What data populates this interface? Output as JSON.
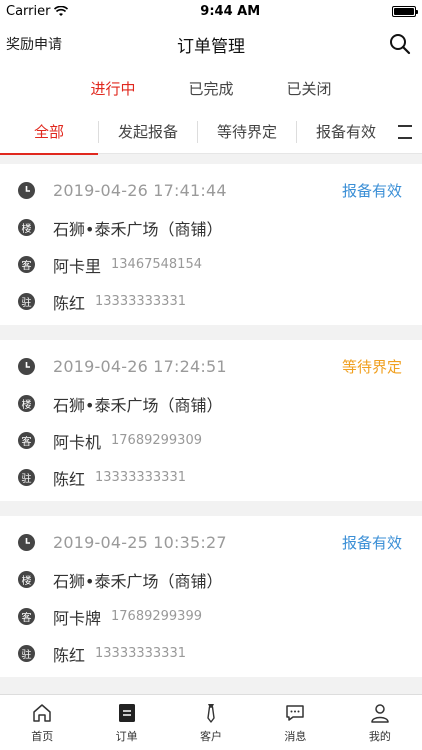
{
  "status_bar": {
    "carrier": "Carrier",
    "time": "9:44 AM",
    "wifi_icon": "wifi-icon",
    "battery_level": 1.0
  },
  "nav": {
    "left_label": "奖励申请",
    "title": "订单管理",
    "search_icon": "search-icon"
  },
  "status_tabs": [
    {
      "label": "进行中",
      "active": true
    },
    {
      "label": "已完成",
      "active": false
    },
    {
      "label": "已关闭",
      "active": false
    }
  ],
  "filter_tabs": [
    {
      "label": "全部",
      "active": true
    },
    {
      "label": "发起报备",
      "active": false
    },
    {
      "label": "等待界定",
      "active": false
    },
    {
      "label": "报备有效",
      "active": false
    }
  ],
  "badges": {
    "building": "楼",
    "customer": "客",
    "agent": "驻"
  },
  "orders": [
    {
      "time": "2019-04-26 17:41:44",
      "status": "报备有效",
      "status_color": "#3b8fd6",
      "property": "石狮•泰禾广场（商铺）",
      "customer_name": "阿卡里",
      "customer_phone": "13467548154",
      "agent_name": "陈红",
      "agent_phone": "13333333331"
    },
    {
      "time": "2019-04-26 17:24:51",
      "status": "等待界定",
      "status_color": "#f0a020",
      "property": "石狮•泰禾广场（商铺）",
      "customer_name": "阿卡机",
      "customer_phone": "17689299309",
      "agent_name": "陈红",
      "agent_phone": "13333333331"
    },
    {
      "time": "2019-04-25 10:35:27",
      "status": "报备有效",
      "status_color": "#3b8fd6",
      "property": "石狮•泰禾广场（商铺）",
      "customer_name": "阿卡牌",
      "customer_phone": "17689299399",
      "agent_name": "陈红",
      "agent_phone": "13333333331"
    }
  ],
  "tab_bar": [
    {
      "label": "首页",
      "icon": "home-icon"
    },
    {
      "label": "订单",
      "icon": "order-icon"
    },
    {
      "label": "客户",
      "icon": "customer-icon"
    },
    {
      "label": "消息",
      "icon": "message-icon"
    },
    {
      "label": "我的",
      "icon": "profile-icon"
    }
  ]
}
